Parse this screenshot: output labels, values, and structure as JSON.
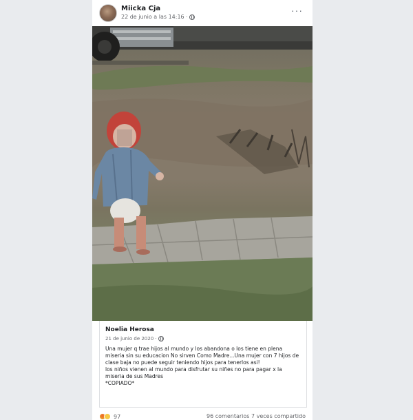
{
  "post": {
    "author": "Miicka Cja",
    "timestamp": "22 de junio a las 14:16 ·",
    "privacy_icon": "globe-icon",
    "more_icon": "more-options-icon",
    "more_label": "···"
  },
  "shared": {
    "author": "Noelia Herosa",
    "timestamp": "21 de junio de 2020 ·",
    "privacy_icon": "globe-icon",
    "text": "Una mujer q trae hijos al mundo y los abandona o los tiene en plena miseria sin su educacion No sirven Como Madre...Una mujer con 7 hijos de clase baja no puede seguir teniendo hijos para tenerlos asi!\nlos niños vienen al mundo para disfrutar su niñes no para pagar x la miseria de sus Madres\n*COPIADO*"
  },
  "footer": {
    "reaction_icons": [
      "angry-icon",
      "haha-icon"
    ],
    "reaction_count": "97",
    "stats": "96 comentarios  7 veces compartido"
  }
}
